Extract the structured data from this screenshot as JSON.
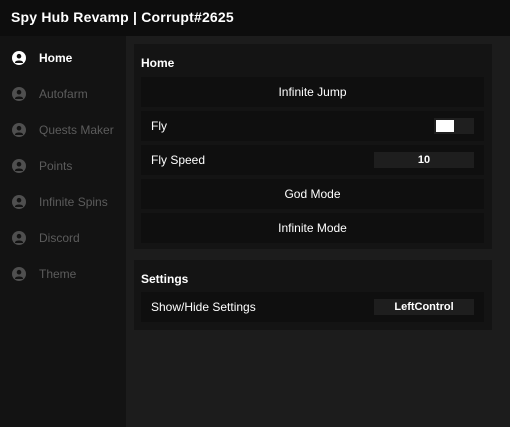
{
  "window": {
    "title": "Spy Hub Revamp | Corrupt#2625"
  },
  "sidebar": {
    "items": [
      {
        "label": "Home",
        "icon": "user-icon"
      },
      {
        "label": "Autofarm",
        "icon": "user-icon"
      },
      {
        "label": "Quests Maker",
        "icon": "user-icon"
      },
      {
        "label": "Points",
        "icon": "user-icon"
      },
      {
        "label": "Infinite Spins",
        "icon": "user-icon"
      },
      {
        "label": "Discord",
        "icon": "user-icon"
      },
      {
        "label": "Theme",
        "icon": "user-icon"
      }
    ],
    "active_index": 0
  },
  "home": {
    "title": "Home",
    "infinite_jump_label": "Infinite Jump",
    "fly": {
      "label": "Fly",
      "toggle_on": true
    },
    "fly_speed": {
      "label": "Fly Speed",
      "value": "10"
    },
    "god_mode_label": "God Mode",
    "infinite_mode_label": "Infinite Mode"
  },
  "settings": {
    "title": "Settings",
    "show_hide": {
      "label": "Show/Hide Settings",
      "keybind": "LeftControl"
    }
  },
  "colors": {
    "accent": "#ffffff",
    "inactive_text": "#5c5c5c",
    "background": "#1c1c1c"
  }
}
